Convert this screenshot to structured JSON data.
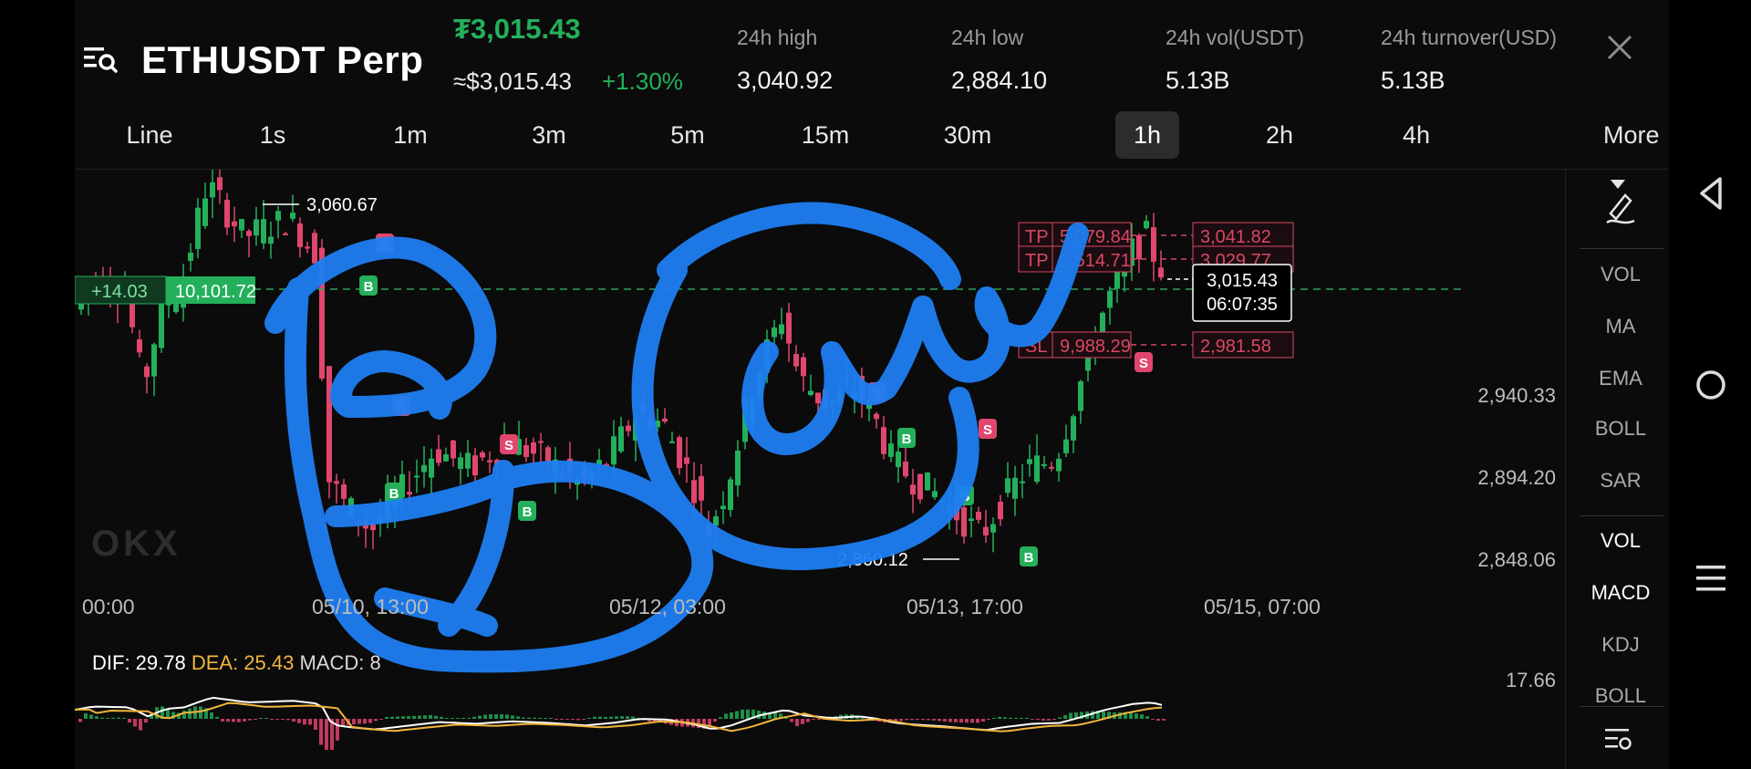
{
  "header": {
    "title": "ETHUSDT Perp",
    "last_price": "₮3,015.43",
    "index_price": "≈$3,015.43",
    "change_pct": "+1.30%",
    "stats": [
      {
        "label": "24h high",
        "value": "3,040.92"
      },
      {
        "label": "24h low",
        "value": "2,884.10"
      },
      {
        "label": "24h vol(USDT)",
        "value": "5.13B"
      },
      {
        "label": "24h turnover(USD)",
        "value": "5.13B"
      }
    ]
  },
  "timeframes": [
    "Line",
    "1s",
    "1m",
    "3m",
    "5m",
    "15m",
    "30m",
    "1h",
    "2h",
    "4h"
  ],
  "active_timeframe": "1h",
  "more_label": "More",
  "chart": {
    "y_labels": [
      "2,940.33",
      "2,894.20",
      "2,848.06"
    ],
    "x_labels": [
      "00:00",
      "05/10, 13:00",
      "05/12, 03:00",
      "05/13, 17:00",
      "05/15, 07:00"
    ],
    "high_marker": "3,060.67",
    "low_marker": "2,860.12",
    "position": {
      "pnl": "+14.03",
      "entry": "10,101.72"
    },
    "orders": [
      {
        "tag": "TP",
        "price": "5,079.84",
        "right": "3,041.82"
      },
      {
        "tag": "TP",
        "price": "2,514.71",
        "right": "3,029.77"
      },
      {
        "tag": "SL",
        "price": "9,988.29",
        "right": "2,981.58"
      }
    ],
    "current_price": "3,015.43",
    "countdown": "06:07:35",
    "watermark": "OKX"
  },
  "macd": {
    "dif_label": "DIF: 29.78",
    "dea_label": "DEA: 25.43",
    "macd_label": "MACD: 8",
    "top_value": "17.66"
  },
  "indicators_main": [
    "VOL",
    "MA",
    "EMA",
    "BOLL",
    "SAR"
  ],
  "indicators_sub": [
    "VOL",
    "MACD",
    "KDJ",
    "BOLL"
  ],
  "colors": {
    "up": "#24b05b",
    "down": "#e0466e",
    "scribble": "#1e7ef2",
    "order_red": "#d94863"
  }
}
